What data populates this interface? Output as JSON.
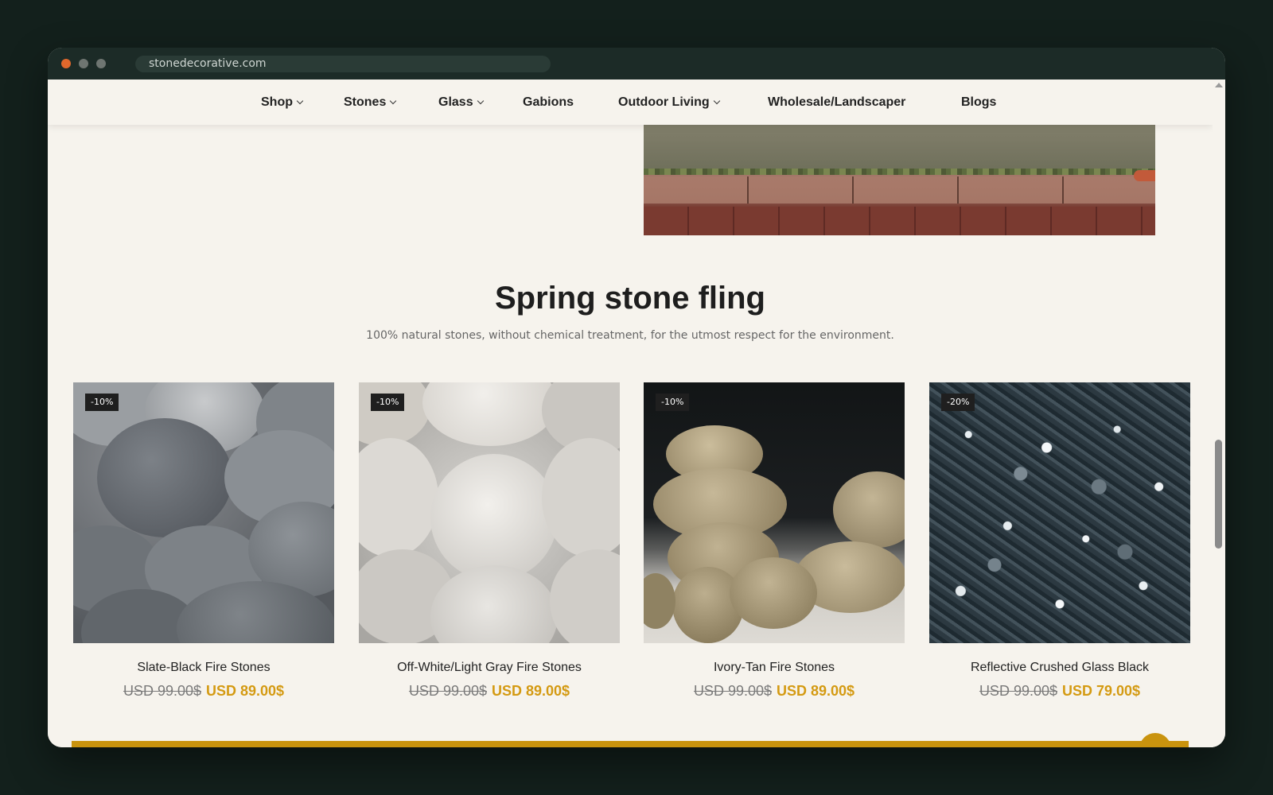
{
  "browser": {
    "url": "stonedecorative.com"
  },
  "nav": {
    "items": [
      {
        "label": "Shop",
        "has_dropdown": true
      },
      {
        "label": "Stones",
        "has_dropdown": true
      },
      {
        "label": "Glass",
        "has_dropdown": true
      },
      {
        "label": "Gabions",
        "has_dropdown": false
      },
      {
        "label": "Outdoor Living",
        "has_dropdown": true
      },
      {
        "label": "Wholesale/Landscaper",
        "has_dropdown": false
      },
      {
        "label": "Blogs",
        "has_dropdown": false
      }
    ]
  },
  "section": {
    "title": "Spring stone fling",
    "subtitle": "100% natural stones, without chemical treatment, for the utmost respect for the environment."
  },
  "products": [
    {
      "badge": "-10%",
      "name": "Slate-Black Fire Stones",
      "old_price": "USD 99.00$",
      "new_price": "USD 89.00$"
    },
    {
      "badge": "-10%",
      "name": "Off-White/Light Gray Fire Stones",
      "old_price": "USD 99.00$",
      "new_price": "USD 89.00$"
    },
    {
      "badge": "-10%",
      "name": "Ivory-Tan Fire Stones",
      "old_price": "USD 99.00$",
      "new_price": "USD 89.00$"
    },
    {
      "badge": "-20%",
      "name": "Reflective Crushed Glass Black",
      "old_price": "USD 99.00$",
      "new_price": "USD 79.00$"
    }
  ],
  "colors": {
    "accent": "#d49a12",
    "background": "#f6f3ed",
    "text": "#222222"
  }
}
